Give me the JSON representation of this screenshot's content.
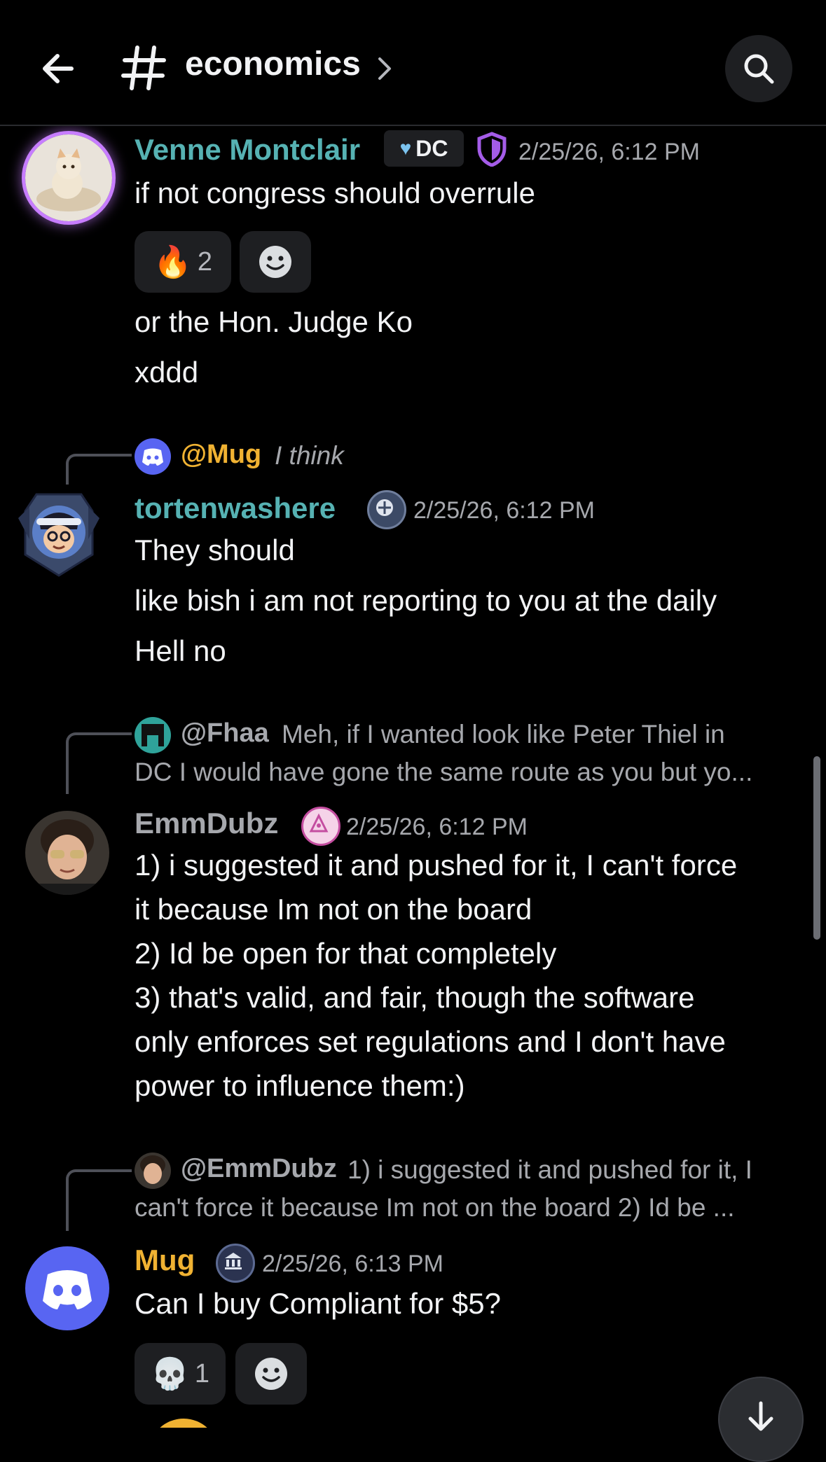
{
  "header": {
    "channel_name": "economics",
    "back_icon": "arrow-left-icon",
    "channel_icon": "hash-icon",
    "search_icon": "search-icon"
  },
  "messages": [
    {
      "author": "Venne Montclair",
      "author_color": "#56b2b3",
      "tag": "DC",
      "timestamp": "2/25/26, 6:12 PM",
      "lines": [
        "if not congress should overrule"
      ],
      "reactions": [
        {
          "emoji": "🔥",
          "count": "2"
        },
        {
          "emoji": "add-reaction-icon"
        }
      ],
      "more_lines": [
        "or the Hon. Judge Ko",
        "xddd"
      ]
    },
    {
      "reply_to": {
        "name": "@Mug",
        "name_color": "#f0b232",
        "preview": "I think"
      },
      "author": "tortenwashere",
      "author_color": "#56b2b3",
      "timestamp": "2/25/26, 6:12 PM",
      "lines": [
        "They should",
        "like bish i am not reporting to you at the daily",
        "Hell no"
      ]
    },
    {
      "reply_to": {
        "name": "@Fhaa",
        "preview_line1": "Meh, if I wanted look like Peter Thiel in",
        "preview_line2": "DC I would have gone the same route as you but yo..."
      },
      "author": "EmmDubz",
      "author_color": "#a6a8ad",
      "timestamp": "2/25/26, 6:12 PM",
      "lines": [
        "1) i suggested it and pushed for it, I can't force",
        "it because Im not on the board",
        "2) Id be open for that completely",
        "3) that's valid, and fair, though the software",
        "only enforces set regulations and I don't have",
        "power to influence them:)"
      ]
    },
    {
      "reply_to": {
        "name": "@EmmDubz",
        "preview_line1": "1) i suggested it and pushed for it, I",
        "preview_line2": "can't force it because Im not on the board 2) Id be ..."
      },
      "author": "Mug",
      "author_color": "#f0b232",
      "timestamp": "2/25/26, 6:13 PM",
      "lines": [
        "Can I buy Compliant for $5?"
      ],
      "reactions": [
        {
          "emoji": "💀",
          "count": "1"
        },
        {
          "emoji": "add-reaction-icon"
        }
      ]
    }
  ],
  "colors": {
    "background": "#000000",
    "discord_blurple": "#5865f2",
    "mention_gold": "#f0b232",
    "teal_name": "#56b2b3"
  }
}
